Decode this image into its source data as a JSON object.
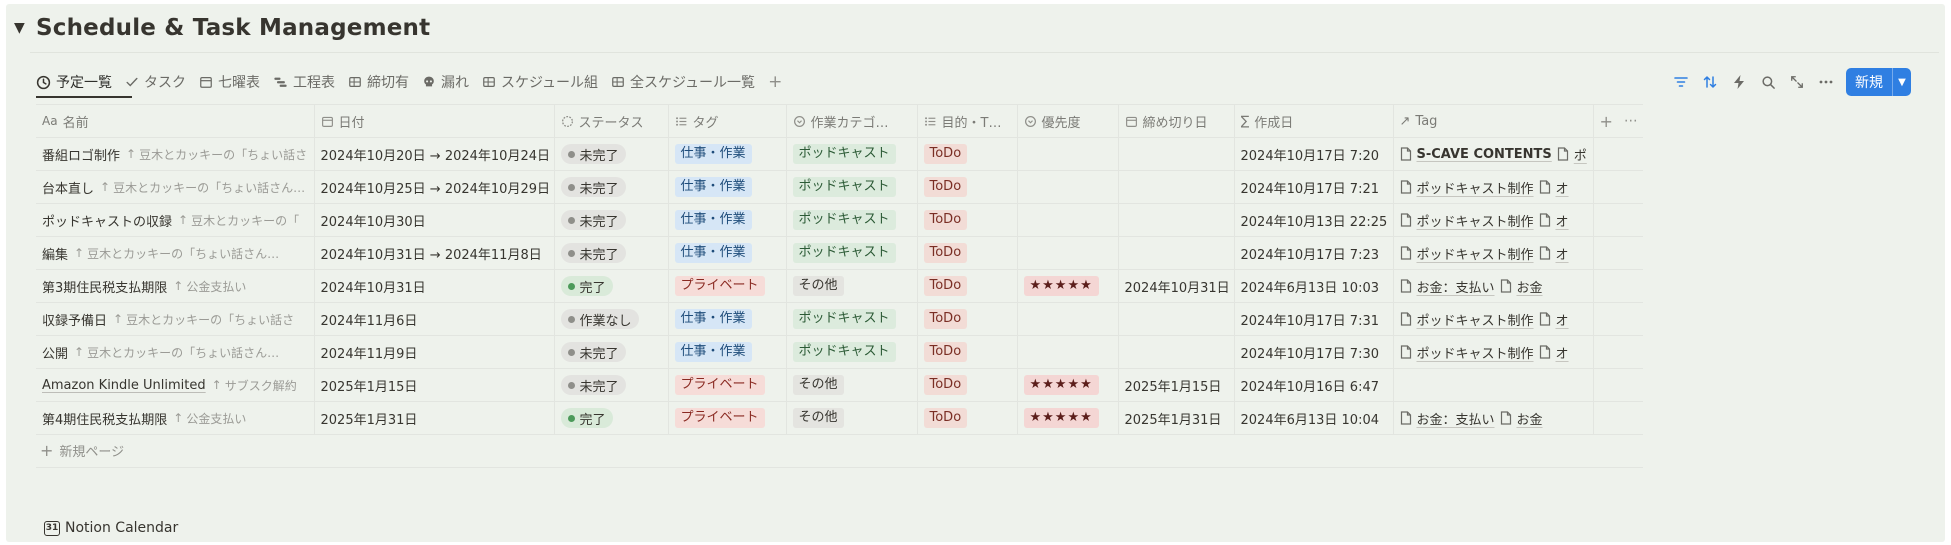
{
  "page": {
    "title": "Schedule & Task Management",
    "toggle_icon": "toggle-triangle-icon"
  },
  "views": [
    {
      "label": "予定一覧",
      "icon": "clock-icon",
      "active": true
    },
    {
      "label": "タスク",
      "icon": "check-icon"
    },
    {
      "label": "七曜表",
      "icon": "calendar-icon"
    },
    {
      "label": "工程表",
      "icon": "timeline-icon"
    },
    {
      "label": "締切有",
      "icon": "table-icon"
    },
    {
      "label": "漏れ",
      "icon": "skull-icon"
    },
    {
      "label": "スケジュール組",
      "icon": "table-icon"
    },
    {
      "label": "全スケジュール一覧",
      "icon": "table-icon"
    }
  ],
  "toolbar": {
    "new_label": "新規",
    "icons": [
      "filter-icon",
      "sort-icon",
      "automation-icon",
      "search-icon",
      "expand-icon",
      "more-icon"
    ]
  },
  "columns": [
    {
      "label": "名前",
      "icon": "Aa"
    },
    {
      "label": "日付",
      "icon": "calendar"
    },
    {
      "label": "ステータス",
      "icon": "status"
    },
    {
      "label": "タグ",
      "icon": "list"
    },
    {
      "label": "作業カテゴ…",
      "icon": "select"
    },
    {
      "label": "目的・T…",
      "icon": "list"
    },
    {
      "label": "優先度",
      "icon": "select"
    },
    {
      "label": "締め切り日",
      "icon": "calendar"
    },
    {
      "label": "作成日",
      "icon": "sigma"
    },
    {
      "label": "Tag",
      "icon": "arrow"
    }
  ],
  "rows": [
    {
      "name": "番組ロゴ制作",
      "rel": "豆木とカッキーの「ちょい話さ",
      "date": "2024年10月20日 → 2024年10月24日",
      "status": "未完了",
      "tag": "仕事・作業",
      "category": "ポッドキャスト",
      "purpose": "ToDo",
      "priority": "",
      "deadline": "",
      "created": "2024年10月17日 7:20",
      "doc1": "S-CAVE CONTENTS",
      "doc2": "ポ"
    },
    {
      "name": "台本直し",
      "rel": "豆木とカッキーの「ちょい話さん…",
      "date": "2024年10月25日 → 2024年10月29日",
      "status": "未完了",
      "tag": "仕事・作業",
      "category": "ポッドキャスト",
      "purpose": "ToDo",
      "priority": "",
      "deadline": "",
      "created": "2024年10月17日 7:21",
      "doc1": "ポッドキャスト制作",
      "doc2": "オ"
    },
    {
      "name": "ポッドキャストの収録",
      "rel": "豆木とカッキーの「",
      "date": "2024年10月30日",
      "status": "未完了",
      "tag": "仕事・作業",
      "category": "ポッドキャスト",
      "purpose": "ToDo",
      "priority": "",
      "deadline": "",
      "created": "2024年10月13日 22:25",
      "doc1": "ポッドキャスト制作",
      "doc2": "オ"
    },
    {
      "name": "編集",
      "rel": "豆木とカッキーの「ちょい話さん…",
      "date": "2024年10月31日 → 2024年11月8日",
      "status": "未完了",
      "tag": "仕事・作業",
      "category": "ポッドキャスト",
      "purpose": "ToDo",
      "priority": "",
      "deadline": "",
      "created": "2024年10月17日 7:23",
      "doc1": "ポッドキャスト制作",
      "doc2": "オ"
    },
    {
      "name": "第3期住民税支払期限",
      "rel": "公金支払い",
      "date": "2024年10月31日",
      "status": "完了",
      "tag": "プライベート",
      "category": "その他",
      "purpose": "ToDo",
      "priority": "★★★★★",
      "deadline": "2024年10月31日",
      "created": "2024年6月13日 10:03",
      "doc1": "お金：支払い",
      "doc2": "お金"
    },
    {
      "name": "収録予備日",
      "rel": "豆木とカッキーの「ちょい話さ",
      "date": "2024年11月6日",
      "status": "作業なし",
      "tag": "仕事・作業",
      "category": "ポッドキャスト",
      "purpose": "ToDo",
      "priority": "",
      "deadline": "",
      "created": "2024年10月17日 7:31",
      "doc1": "ポッドキャスト制作",
      "doc2": "オ"
    },
    {
      "name": "公開",
      "rel": "豆木とカッキーの「ちょい話さん…",
      "date": "2024年11月9日",
      "status": "未完了",
      "tag": "仕事・作業",
      "category": "ポッドキャスト",
      "purpose": "ToDo",
      "priority": "",
      "deadline": "",
      "created": "2024年10月17日 7:30",
      "doc1": "ポッドキャスト制作",
      "doc2": "オ"
    },
    {
      "name": "Amazon Kindle Unlimited",
      "rel": "サブスク解約",
      "date": "2025年1月15日",
      "status": "未完了",
      "tag": "プライベート",
      "category": "その他",
      "purpose": "ToDo",
      "priority": "★★★★★",
      "deadline": "2025年1月15日",
      "created": "2024年10月16日 6:47",
      "doc1": "",
      "doc2": ""
    },
    {
      "name": "第4期住民税支払期限",
      "rel": "公金支払い",
      "date": "2025年1月31日",
      "status": "完了",
      "tag": "プライベート",
      "category": "その他",
      "purpose": "ToDo",
      "priority": "★★★★★",
      "deadline": "2025年1月31日",
      "created": "2024年6月13日 10:04",
      "doc1": "お金：支払い",
      "doc2": "お金"
    }
  ],
  "new_page_label": "新規ページ",
  "calendar_link": {
    "label": "Notion Calendar",
    "badge": "31"
  },
  "colors": {
    "accent": "#2f7fe2",
    "status_done": "#4c9a5a",
    "status_pending": "#8f8f8a"
  }
}
